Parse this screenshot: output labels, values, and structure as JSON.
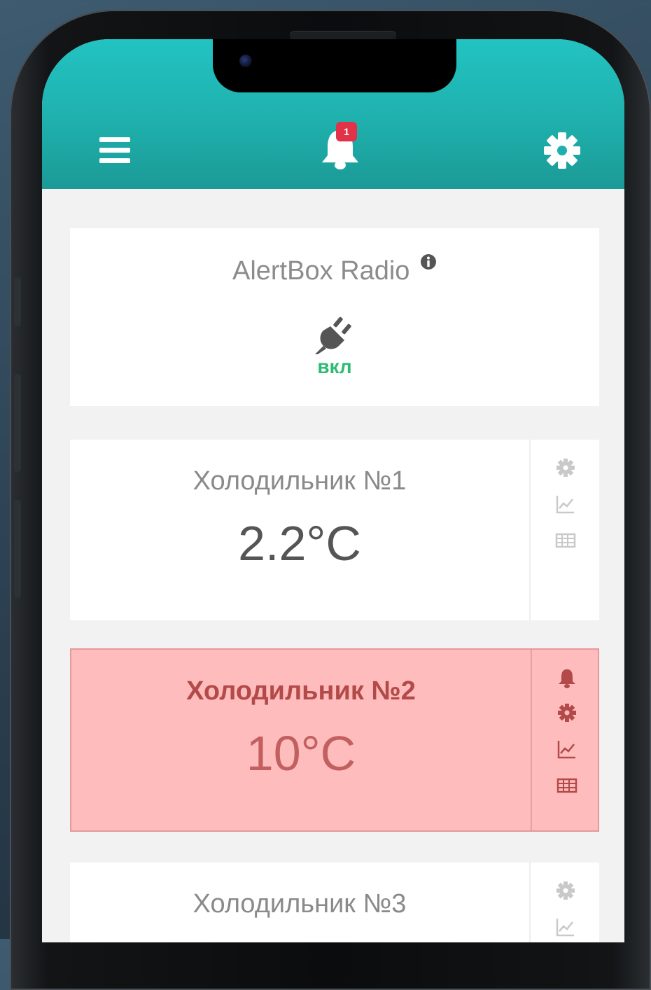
{
  "header": {
    "notification_count": "1",
    "menu_icon": "hamburger-menu-icon",
    "bell_icon": "bell-icon",
    "settings_icon": "gear-icon"
  },
  "radio": {
    "title": "AlertBox Radio",
    "status": "вкл",
    "status_color": "#2dbb73",
    "icons": [
      "info-icon",
      "plug-icon"
    ]
  },
  "sensors": [
    {
      "name": "Холодильник №1",
      "temp": "2.2°C",
      "alarm": false
    },
    {
      "name": "Холодильник №2",
      "temp": "10°C",
      "alarm": true
    },
    {
      "name": "Холодильник №3",
      "temp": "",
      "alarm": false
    }
  ],
  "colors": {
    "header": "#1fb0ad",
    "alarm_bg": "#ffbcbc",
    "alarm_text": "#b34a4a",
    "badge": "#e0334a"
  }
}
